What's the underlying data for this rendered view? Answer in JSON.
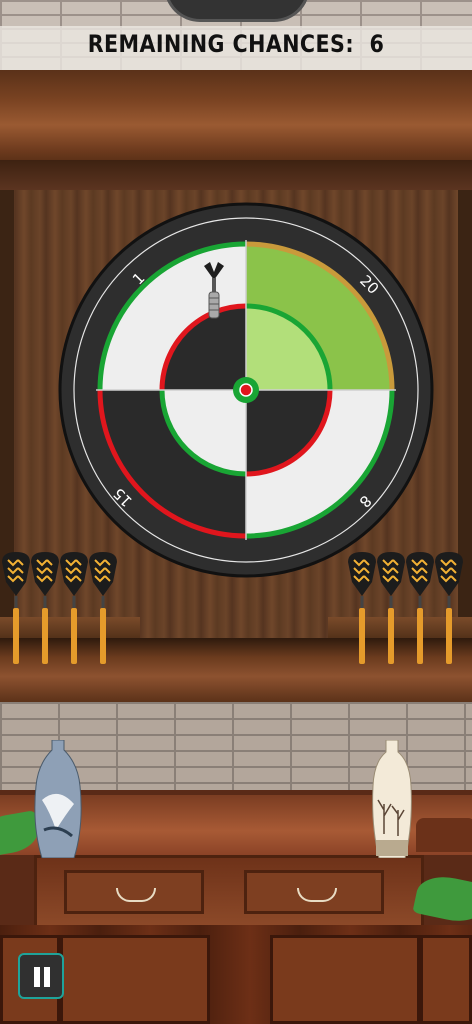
{
  "hud": {
    "remaining_label": "REMAINING CHANCES:",
    "remaining_count": "6"
  },
  "board": {
    "numbers": {
      "top_left": "1",
      "top_right": "20",
      "bottom_left": "15",
      "bottom_right": "8"
    },
    "colors": {
      "outer": "#2e2e2e",
      "white_segment": "#eeeeee",
      "black_segment": "#2a2a2a",
      "highlight": "#8bc34a",
      "highlight_light": "#b2df7a",
      "ring_green": "#19a534",
      "ring_red": "#e0161d",
      "ring_orange": "#c99a3b"
    }
  },
  "darts": {
    "left_rack_count": 4,
    "right_rack_count": 4,
    "flight_color": "#f2b134",
    "shaft_color": "#e59b2b"
  },
  "controls": {
    "pause_icon": "pause-icon"
  }
}
